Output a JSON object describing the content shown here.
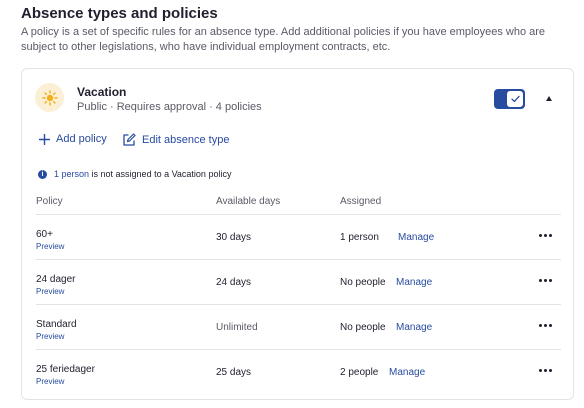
{
  "section": {
    "title": "Absence types and policies",
    "description": "A policy is a set of specific rules for an absence type. Add additional policies if you have employees who are subject to other legislations, who have individual employment contracts, etc."
  },
  "absence_type": {
    "name": "Vacation",
    "meta": "Public · Requires approval · 4 policies",
    "icon": "sun-icon",
    "enabled": true
  },
  "actions": {
    "add_policy": "Add policy",
    "edit_absence_type": "Edit absence type"
  },
  "notice": {
    "link": "1 person",
    "text": " is not assigned to a Vacation policy"
  },
  "table": {
    "headers": {
      "policy": "Policy",
      "available_days": "Available days",
      "assigned": "Assigned"
    },
    "rows": [
      {
        "name": "60+",
        "preview": "Preview",
        "days": "30 days",
        "assigned": "1 person",
        "manage": "Manage"
      },
      {
        "name": "24 dager",
        "preview": "Preview",
        "days": "24 days",
        "assigned": "No people",
        "manage": "Manage"
      },
      {
        "name": "Standard",
        "preview": "Preview",
        "days": "Unlimited",
        "assigned": "No people",
        "manage": "Manage"
      },
      {
        "name": "25 feriedager",
        "preview": "Preview",
        "days": "25 days",
        "assigned": "2 people",
        "manage": "Manage"
      }
    ]
  },
  "colors": {
    "accent": "#274b9f",
    "sun_badge_bg": "#fbf0d6",
    "sun": "#f2b01e",
    "border": "#e4e4e8",
    "muted_text": "#5a5a66"
  }
}
